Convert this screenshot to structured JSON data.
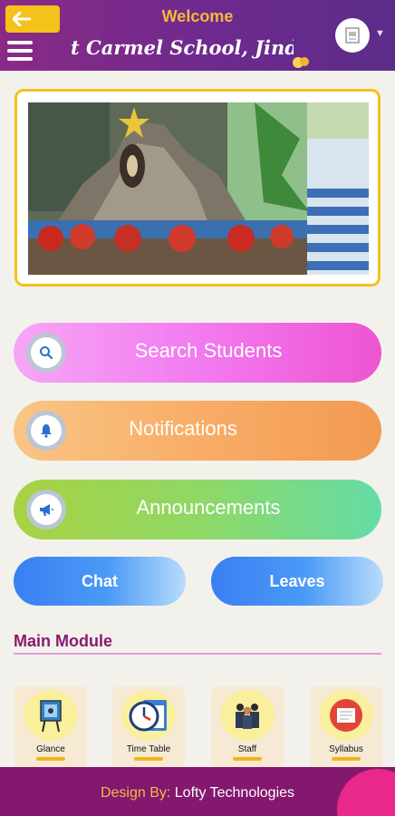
{
  "header": {
    "welcome": "Welcome",
    "school_name": "t Carmel School, Jindwari",
    "back_icon": "arrow-left-icon",
    "menu_icon": "hamburger-icon",
    "colors": {
      "bar": "#7a2a8a",
      "accent": "#f4c21a"
    }
  },
  "actions": {
    "search": {
      "label": "Search Students",
      "icon": "search-icon"
    },
    "notifications": {
      "label": "Notifications",
      "icon": "bell-icon"
    },
    "announcements": {
      "label": "Announcements",
      "icon": "megaphone-icon"
    },
    "chat": {
      "label": "Chat"
    },
    "leaves": {
      "label": "Leaves"
    }
  },
  "main_module": {
    "title": "Main Module",
    "items": [
      {
        "label": "Glance",
        "icon": "easel-icon"
      },
      {
        "label": "Time Table",
        "icon": "clock-calendar-icon"
      },
      {
        "label": "Staff",
        "icon": "people-icon"
      },
      {
        "label": "Syllabus",
        "icon": "book-icon"
      }
    ]
  },
  "footer": {
    "design_by": "Design By:",
    "company": "Lofty Technologies"
  }
}
